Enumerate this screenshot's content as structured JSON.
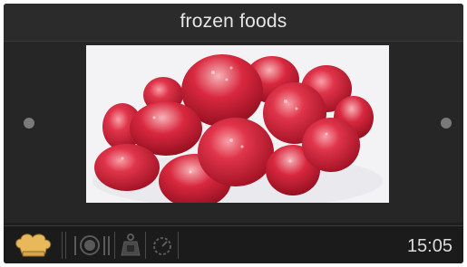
{
  "header": {
    "title": "frozen foods"
  },
  "navigation": {
    "prev_icon": "dot-left-icon",
    "next_icon": "dot-right-icon"
  },
  "content": {
    "image_subject": "strawberries"
  },
  "footer": {
    "icons": [
      "chef-hat-icon",
      "plate-cutlery-icon",
      "weight-icon",
      "timer-icon"
    ],
    "time": "15:05"
  },
  "colors": {
    "accent": "#e8b85a",
    "background": "#1e1e1e",
    "text": "#e6e6e6"
  }
}
